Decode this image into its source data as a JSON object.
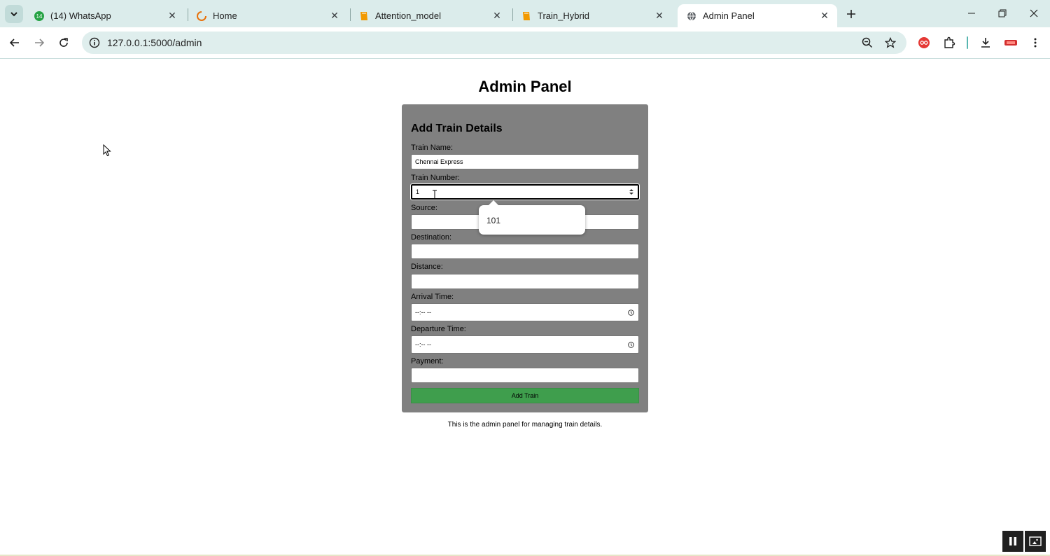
{
  "browser": {
    "tabs": [
      {
        "title": "(14) WhatsApp",
        "favicon": "whatsapp-icon",
        "badge": "14"
      },
      {
        "title": "Home",
        "favicon": "loading-spinner-icon"
      },
      {
        "title": "Attention_model",
        "favicon": "notebook-icon"
      },
      {
        "title": "Train_Hybrid",
        "favicon": "notebook-icon"
      },
      {
        "title": "Admin Panel",
        "favicon": "globe-icon",
        "active": true
      }
    ],
    "close_glyph": "✕",
    "url": "127.0.0.1:5000/admin",
    "accent": "#dbeceb"
  },
  "page": {
    "title": "Admin Panel",
    "form": {
      "heading": "Add Train Details",
      "train_name_label": "Train Name:",
      "train_name_value": "Chennai Express",
      "train_number_label": "Train Number:",
      "train_number_value": "1",
      "source_label": "Source:",
      "destination_label": "Destination:",
      "distance_label": "Distance:",
      "arrival_label": "Arrival Time:",
      "arrival_value": "--:-- --",
      "departure_label": "Departure Time:",
      "departure_value": "--:-- --",
      "payment_label": "Payment:",
      "submit_label": "Add Train",
      "submit_color": "#3f9e4d",
      "card_color": "#808080"
    },
    "autocomplete_option": "101",
    "footer": "This is the admin panel for managing train details."
  }
}
